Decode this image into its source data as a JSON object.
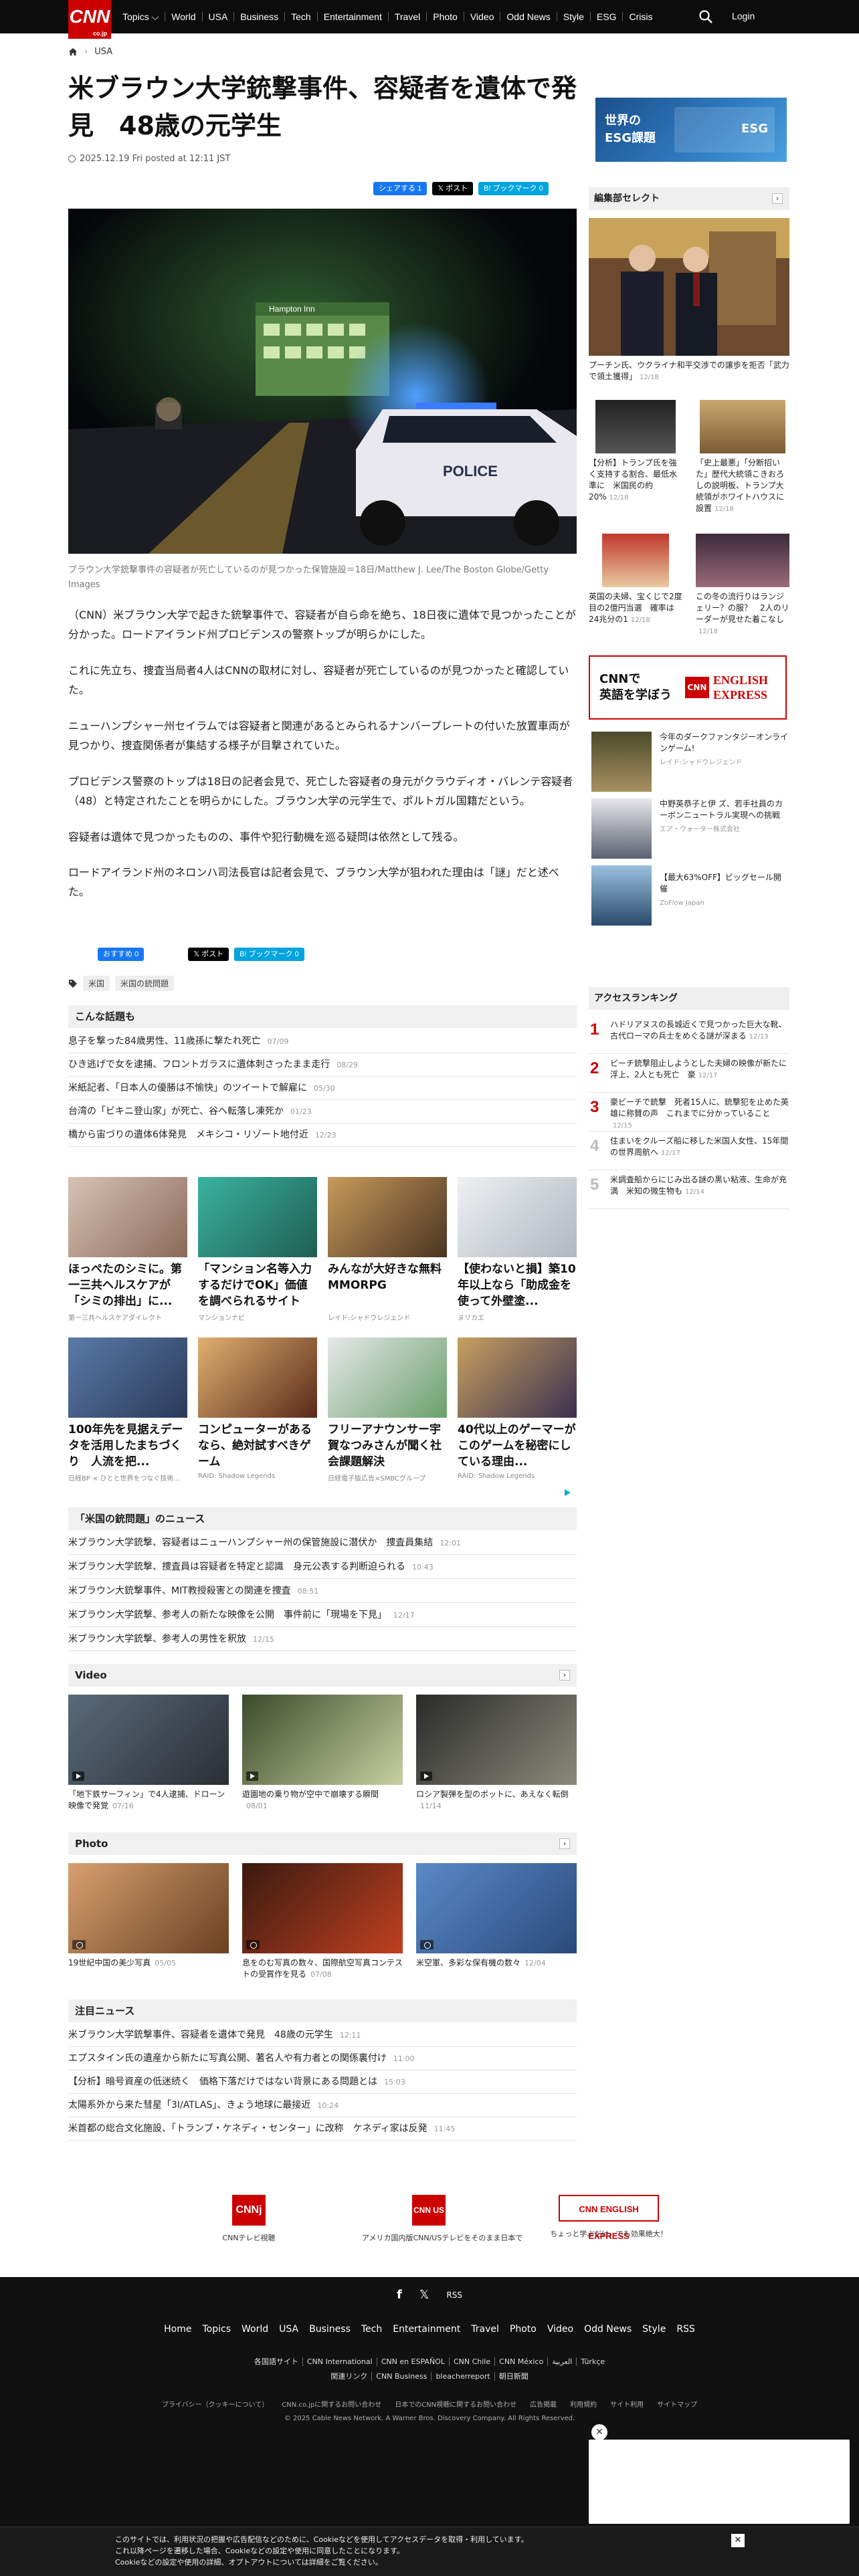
{
  "nav": {
    "logo": "CNN",
    "logo_sub": "co.jp",
    "items": [
      "Topics ⌵",
      "World",
      "USA",
      "Business",
      "Tech",
      "Entertainment",
      "Travel",
      "Photo",
      "Video",
      "Odd News",
      "Style",
      "ESG",
      "Crisis"
    ],
    "login": "Login"
  },
  "breadcrumb": {
    "section": "USA"
  },
  "article": {
    "title": "米ブラウン大学銃撃事件、容疑者を遺体で発見　48歳の元学生",
    "posted": "2025.12.19 Fri posted at 12:11 JST",
    "share": {
      "fb": "シェアする",
      "fb_count": "1",
      "x": "ポスト",
      "hb": "ブックマーク",
      "hb_count": "0"
    },
    "photo_sign": "Hampton Inn",
    "caption": "ブラウン大学銃撃事件の容疑者が死亡しているのが見つかった保管施設＝18日/Matthew J. Lee/The Boston Globe/Getty Images",
    "paragraphs": [
      "（CNN）米ブラウン大学で起きた銃撃事件で、容疑者が自ら命を絶ち、18日夜に遺体で見つかったことが分かった。ロードアイランド州プロビデンスの警察トップが明らかにした。",
      "これに先立ち、捜査当局者4人はCNNの取材に対し、容疑者が死亡しているのが見つかったと確認していた。",
      "ニューハンプシャー州セイラムでは容疑者と関連があるとみられるナンバープレートの付いた放置車両が見つかり、捜査関係者が集結する様子が目撃されていた。",
      "プロビデンス警察のトップは18日の記者会見で、死亡した容疑者の身元がクラウディオ・バレンテ容疑者（48）と特定されたことを明らかにした。ブラウン大学の元学生で、ポルトガル国籍だという。",
      "容疑者は遺体で見つかったものの、事件や犯行動機を巡る疑問は依然として残る。",
      "ロードアイランド州のネロンハ司法長官は記者会見で、ブラウン大学が狙われた理由は「謎」だと述べた。"
    ],
    "share_bottom": {
      "fb": "おすすめ",
      "fb_count": "0",
      "x": "ポスト",
      "hb": "ブックマーク",
      "hb_count": "0"
    },
    "tags": [
      "米国",
      "米国の銃問題"
    ]
  },
  "konna": {
    "heading": "こんな話題も",
    "items": [
      {
        "text": "息子を撃った84歳男性、11歳孫に撃たれ死亡",
        "date": "07/09"
      },
      {
        "text": "ひき逃げで女を逮捕、フロントガラスに遺体刺さったまま走行",
        "date": "08/29"
      },
      {
        "text": "米紙記者、「日本人の優勝は不愉快」のツイートで解雇に",
        "date": "05/30"
      },
      {
        "text": "台湾の「ビキニ登山家」が死亡、谷へ転落し凍死か",
        "date": "01/23"
      },
      {
        "text": "橋から宙づりの遺体6体発見　メキシコ・リゾート地付近",
        "date": "12/23"
      }
    ]
  },
  "ads": [
    {
      "title": "ほっぺたのシミに。第一三共ヘルスケアが「シミの排出」に...",
      "source": "第一三共ヘルスケアダイレクト"
    },
    {
      "title": "「マンション名等入力するだけでOK」価値を調べられるサイト",
      "source": "マンションナビ"
    },
    {
      "title": "みんなが大好きな無料MMORPG",
      "source": "レイド:シャドウレジェンド"
    },
    {
      "title": "【使わないと損】築10年以上なら「助成金を使って外壁塗...",
      "source": "ヌリカエ"
    },
    {
      "title": "100年先を見据えデータを活用したまちづくり　人流を把...",
      "source": "日経BP × ひとと世界をつなぐ技術..."
    },
    {
      "title": "コンピューターがあるなら、絶対試すべきゲーム",
      "source": "RAID: Shadow Legends"
    },
    {
      "title": "フリーアナウンサー宇賀なつみさんが聞く社会課題解決",
      "source": "日経電子版広告×SMBCグループ"
    },
    {
      "title": "40代以上のゲーマーがこのゲームを秘密にしている理由...",
      "source": "RAID: Shadow Legends"
    }
  ],
  "gun_news": {
    "heading": "「米国の銃問題」のニュース",
    "items": [
      {
        "text": "米ブラウン大学銃撃、容疑者はニューハンプシャー州の保管施設に潜伏か　捜査員集結",
        "date": "12:01"
      },
      {
        "text": "米ブラウン大学銃撃、捜査員は容疑者を特定と認識　身元公表する判断迫られる",
        "date": "10:43"
      },
      {
        "text": "米ブラウン大銃撃事件、MIT教授殺害との関連を捜査",
        "date": "08:51"
      },
      {
        "text": "米ブラウン大学銃撃、参考人の新たな映像を公開　事件前に「現場を下見」",
        "date": "12/17"
      },
      {
        "text": "米ブラウン大学銃撃、参考人の男性を釈放",
        "date": "12/15"
      }
    ]
  },
  "video": {
    "heading": "Video",
    "items": [
      {
        "title": "「地下鉄サーフィン」で4人逮捕、ドローン映像で発覚",
        "date": "07/16"
      },
      {
        "title": "遊園地の乗り物が空中で崩壊する瞬間",
        "date": "08/01"
      },
      {
        "title": "ロシア製弾を型のボットに、あえなく転倒",
        "date": "11/14"
      }
    ]
  },
  "photo": {
    "heading": "Photo",
    "items": [
      {
        "title": "19世紀中国の美少写真",
        "date": "05/05"
      },
      {
        "title": "息をのむ写真の数々、国際航空写真コンテストの受賞作を見る",
        "date": "07/08"
      },
      {
        "title": "米空軍、多彩な保有機の数々",
        "date": "12/04"
      }
    ]
  },
  "chumoku": {
    "heading": "注目ニュース",
    "items": [
      {
        "text": "米ブラウン大学銃撃事件、容疑者を遺体で発見　48歳の元学生",
        "date": "12:11"
      },
      {
        "text": "エプスタイン氏の遺産から新たに写真公開、著名人や有力者との関係裏付け",
        "date": "11:00"
      },
      {
        "text": "【分析】暗号資産の低迷続く　価格下落だけではない背景にある問題とは",
        "date": "15:03"
      },
      {
        "text": "太陽系外から来た彗星「3I/ATLAS」、きょう地球に最接近",
        "date": "10:24"
      },
      {
        "text": "米首都の総合文化施設、「トランプ・ケネディ・センター」に改称　ケネディ家は反発",
        "date": "11:45"
      }
    ]
  },
  "sidebar": {
    "esg_title": "世界の\nESG課題",
    "esg_badge": "ESG",
    "editors_pick": "編集部セレクト",
    "big_caption": "プーチン氏、ウクライナ和平交渉での譲歩を拒否「武力で領土獲得」",
    "big_date": "12/18",
    "grid": [
      {
        "text": "【分析】トランプ氏を強く支持する割合、最低水準に　米国民の約20%",
        "date": "12/18"
      },
      {
        "text": "「史上最悪」「分断招いた」歴代大統領こきおろしの説明板、トランプ大統領がホワイトハウスに設置",
        "date": "12/18"
      },
      {
        "text": "英国の夫婦、宝くじで2度目の2億円当選　確率は24兆分の1",
        "date": "12/18"
      },
      {
        "text": "この冬の流行りはランジェリー？の服？　2人のリーダーが見せた着こなし",
        "date": "12/18"
      }
    ],
    "cnnee": {
      "label": "CNNで\n英語を学ぼう",
      "logo_cnn": "CNN",
      "logo_text": "ENGLISH\nEXPRESS"
    },
    "promos": [
      {
        "text": "今年のダークファンタジーオンラインゲーム!",
        "src": "レイド:シャドウレジェンド"
      },
      {
        "text": "中野英恭子と伊 ズ、若手社員のカーボンニュートラル実現への挑戦",
        "src": "エア・ウォーター株式会社"
      },
      {
        "text": "【最大63%OFF】ビッグセール開催",
        "src": "ZoFlow Japan"
      }
    ],
    "ranking_heading": "アクセスランキング",
    "ranking": [
      {
        "num": "1",
        "text": "ハドリアヌスの長城近くで見つかった巨大な靴、古代ローマの兵士をめぐる謎が深まる",
        "date": "12/13"
      },
      {
        "num": "2",
        "text": "ビーチ銃撃阻止しようとした夫婦の映像が新たに浮上、2人とも死亡　豪",
        "date": "12/17"
      },
      {
        "num": "3",
        "text": "豪ビーチで銃撃　死者15人に、銃撃犯を止めた英雄に称賛の声　これまでに分かっていること",
        "date": "12/15"
      },
      {
        "num": "4",
        "text": "住まいをクルーズ船に移した米国人女性、15年間の世界周航へ",
        "date": "12/17"
      },
      {
        "num": "5",
        "text": "米調査船からにじみ出る謎の黒い粘液、生命が充満　米知の微生物も",
        "date": "12/14"
      }
    ]
  },
  "footer_logos": [
    {
      "logo": "CNNj",
      "label": "CNNテレビ視聴"
    },
    {
      "logo": "CNN US",
      "label": "アメリカ国内版CNN/USテレビをそのまま日本で"
    },
    {
      "logo": "CNN ENGLISH EXPRESS",
      "label": "ちょっと学ぶだけ。でも効果絶大！"
    }
  ],
  "footer": {
    "social": [
      "f",
      "𝕏",
      "RSS"
    ],
    "nav": [
      "Home",
      "Topics",
      "World",
      "USA",
      "Business",
      "Tech",
      "Entertainment",
      "Travel",
      "Photo",
      "Video",
      "Odd News",
      "Style",
      "RSS"
    ],
    "sub1": [
      "各国語サイト",
      "CNN International",
      "CNN en ESPAÑOL",
      "CNN Chile",
      "CNN México",
      "العربية",
      "Türkçe"
    ],
    "sub2": [
      "関連リンク",
      "CNN Business",
      "bleacherreport",
      "朝日新聞"
    ],
    "legal": [
      "プライバシー（クッキーについて）",
      "CNN.co.jpに関するお問い合わせ",
      "日本でのCNN視聴に関するお問い合わせ",
      "広告掲載",
      "利用規約",
      "サイト利用",
      "サイトマップ"
    ],
    "copyright": "© 2025 Cable News Network. A Warner Bros. Discovery Company. All Rights Reserved."
  },
  "cookie": {
    "text": "このサイトでは、利用状況の把握や広告配信などのために、Cookieなどを使用してアクセスデータを取得・利用しています。\nこれ以降ページを遷移した場合、Cookieなどの設定や使用に同意したことになります。\nCookieなどの設定や使用の詳細、オプトアウトについては詳細をご覧ください。",
    "close": "✕"
  }
}
